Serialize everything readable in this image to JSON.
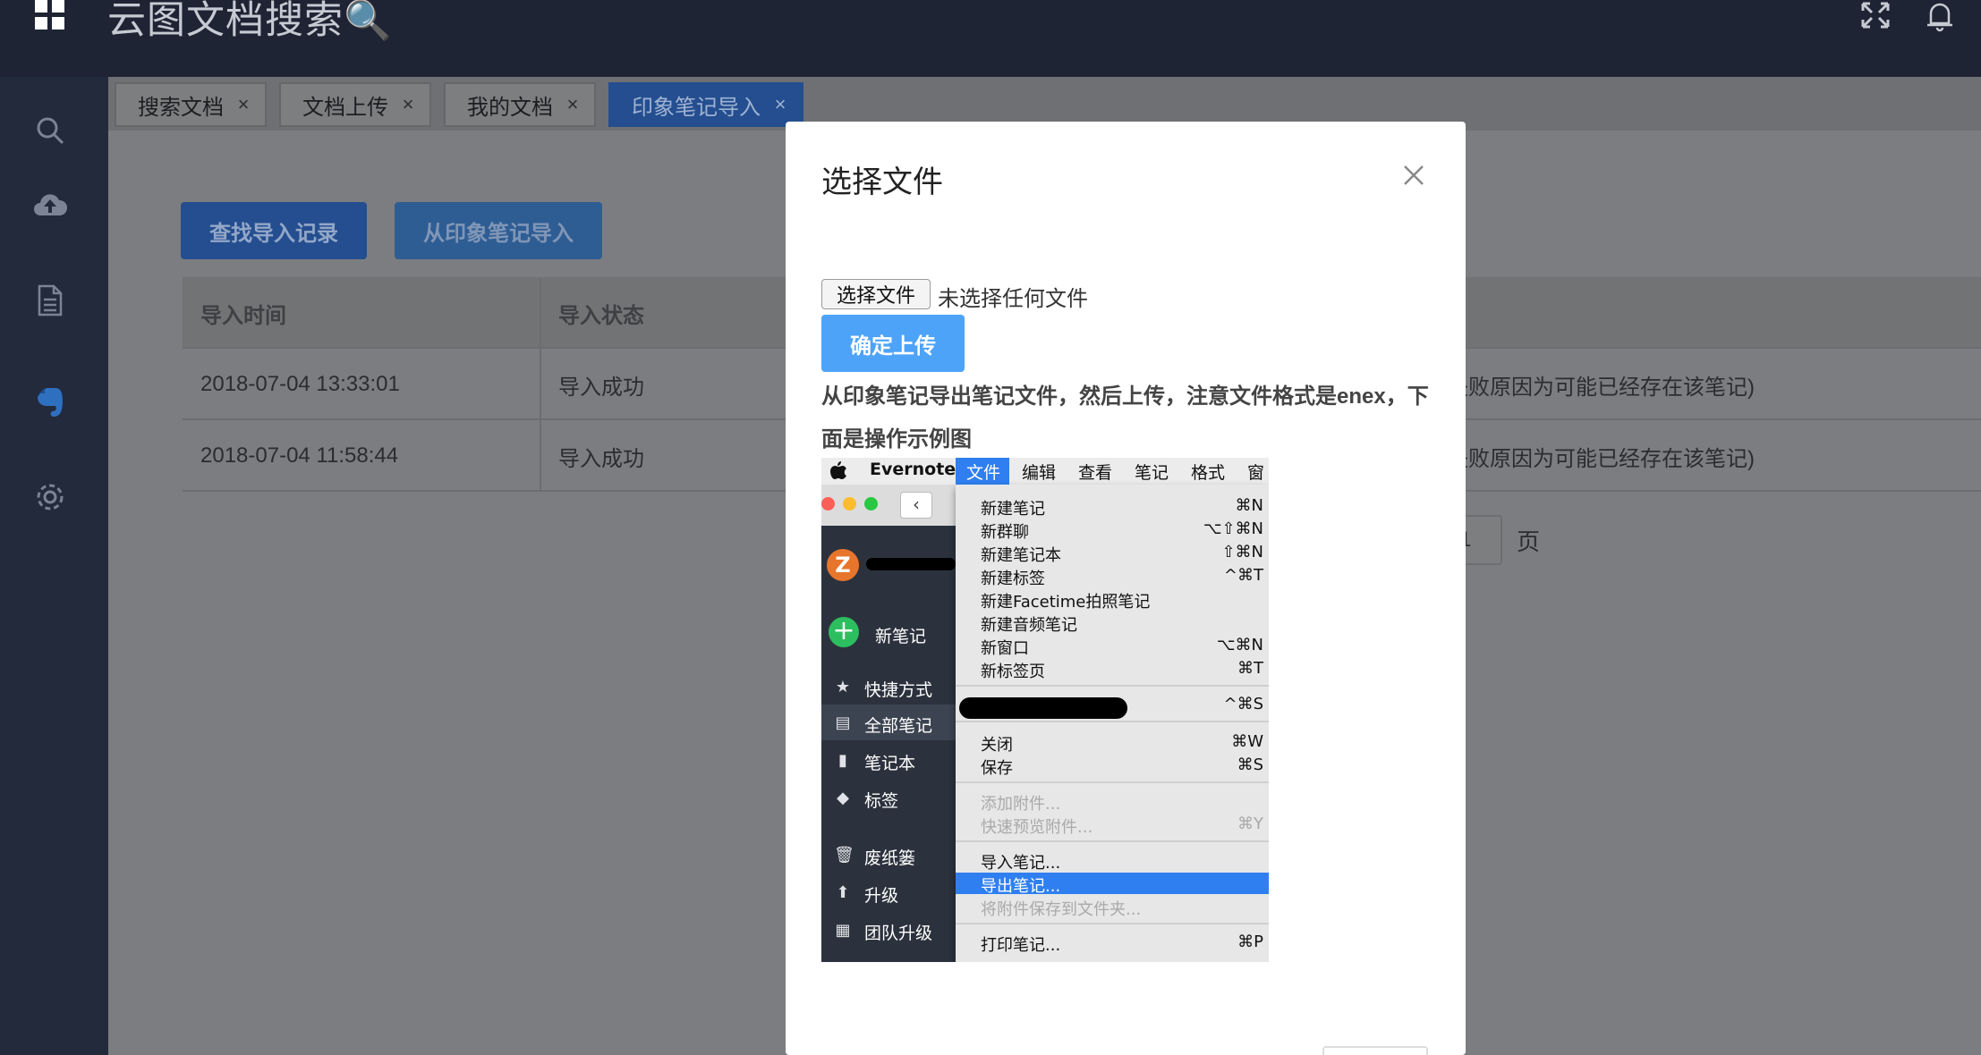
{
  "header": {
    "title": "云图文档搜索🔍",
    "apps_icon": "grid-icon",
    "fullscreen_icon": "fullscreen-icon",
    "bell_icon": "bell-icon"
  },
  "sidebar": {
    "items": [
      {
        "icon": "search-icon"
      },
      {
        "icon": "cloud-upload-icon"
      },
      {
        "icon": "document-icon"
      },
      {
        "icon": "evernote-icon",
        "active": true
      },
      {
        "icon": "settings-icon"
      }
    ]
  },
  "tabs": [
    {
      "label": "搜索文档",
      "close": "×"
    },
    {
      "label": "文档上传",
      "close": "×"
    },
    {
      "label": "我的文档",
      "close": "×"
    },
    {
      "label": "印象笔记导入",
      "close": "×",
      "active": true
    }
  ],
  "toolbar": {
    "query_label": "查找导入记录",
    "import_label": "从印象笔记导入"
  },
  "table": {
    "columns": [
      "导入时间",
      "导入状态"
    ],
    "rows": [
      {
        "time": "2018-07-04 13:33:01",
        "status": "导入成功",
        "note": "失败原因为可能已经存在该笔记)"
      },
      {
        "time": "2018-07-04 11:58:44",
        "status": "导入成功",
        "note": "失败原因为可能已经存在该笔记)"
      }
    ]
  },
  "pagination": {
    "page_value": "1",
    "page_unit": "页"
  },
  "modal": {
    "title": "选择文件",
    "close_icon": "close-icon",
    "file_button": "选择文件",
    "file_status": "未选择任何文件",
    "confirm_label": "确定上传",
    "description": "从印象笔记导出笔记文件，然后上传，注意文件格式是enex，下面是操作示例图",
    "screenshot": {
      "menubar": {
        "app": "Evernote",
        "menus": [
          "文件",
          "编辑",
          "查看",
          "笔记",
          "格式",
          "窗"
        ]
      },
      "sidebar": {
        "avatar": "Z",
        "new_note": "新笔记",
        "items": [
          "快捷方式",
          "全部笔记",
          "笔记本",
          "标签",
          "废纸篓",
          "升级",
          "团队升级"
        ]
      },
      "menu_items": [
        {
          "label": "新建笔记",
          "shortcut": "⌘N"
        },
        {
          "label": "新群聊",
          "shortcut": "⌥⇧⌘N"
        },
        {
          "label": "新建笔记本",
          "shortcut": "⇧⌘N"
        },
        {
          "label": "新建标签",
          "shortcut": "^⌘T"
        },
        {
          "label": "新建Facetime拍照笔记",
          "shortcut": ""
        },
        {
          "label": "新建音频笔记",
          "shortcut": ""
        },
        {
          "label": "新窗口",
          "shortcut": "⌥⌘N"
        },
        {
          "label": "新标签页",
          "shortcut": "⌘T"
        },
        {
          "label": "",
          "shortcut": "^⌘S"
        },
        {
          "label": "关闭",
          "shortcut": "⌘W"
        },
        {
          "label": "保存",
          "shortcut": "⌘S"
        },
        {
          "label": "添加附件...",
          "shortcut": ""
        },
        {
          "label": "快速预览附件...",
          "shortcut": "⌘Y"
        },
        {
          "label": "导入笔记...",
          "shortcut": ""
        },
        {
          "label": "导出笔记...",
          "shortcut": ""
        },
        {
          "label": "将附件保存到文件夹...",
          "shortcut": ""
        },
        {
          "label": "打印笔记...",
          "shortcut": "⌘P"
        }
      ]
    }
  }
}
